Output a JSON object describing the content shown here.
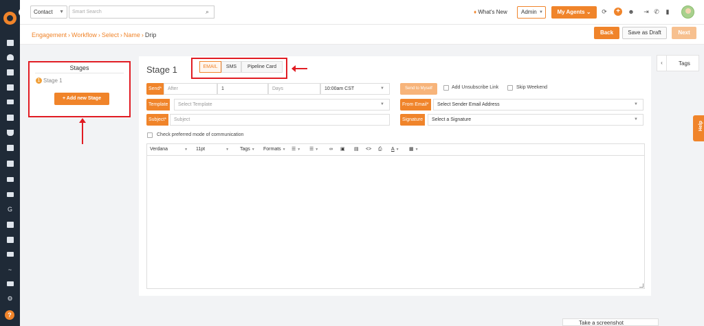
{
  "topbar": {
    "contact_select": "Contact",
    "search_placeholder": "Smart Search",
    "whats_new": "What's New",
    "admin_select": "Admin",
    "agents_button": "My Agents"
  },
  "breadcrumb": [
    "Engagement",
    "Workflow",
    "Select",
    "Name",
    "Drip"
  ],
  "actions": {
    "back": "Back",
    "save_draft": "Save as Draft",
    "next": "Next"
  },
  "stages": {
    "title": "Stages",
    "items": [
      {
        "number": "1",
        "label": "Stage 1"
      }
    ],
    "add_button": "Add new Stage"
  },
  "editor": {
    "stage_title": "Stage 1",
    "channels": [
      "EMAIL",
      "SMS",
      "Pipeline Card"
    ],
    "active_channel": "EMAIL",
    "send_label": "Send*",
    "after_placeholder": "After",
    "delay_value": "1",
    "delay_unit": "Days",
    "time_value": "10:00am CST",
    "template_label": "Template",
    "template_placeholder": "Select Template",
    "subject_label": "Subject*",
    "subject_placeholder": "Subject",
    "send_to_myself": "Send to Myself",
    "add_unsubscribe": "Add Unsubscribe Link",
    "skip_weekend": "Skip Weekend",
    "from_email_label": "From Email*",
    "from_email_value": "Select Sender Email Address",
    "signature_label": "Signature",
    "signature_value": "Select a Signature",
    "preferred_mode": "Check preferred mode of communication",
    "toolbar": {
      "font": "Verdana",
      "size": "11pt",
      "tags": "Tags",
      "formats": "Formats"
    }
  },
  "tags_panel": {
    "label": "Tags"
  },
  "help_tab": "Help",
  "screenshot_bar": "Take a screenshot",
  "colors": {
    "accent": "#f0842a",
    "rail": "#1f2a37",
    "highlight": "#e11b22"
  }
}
